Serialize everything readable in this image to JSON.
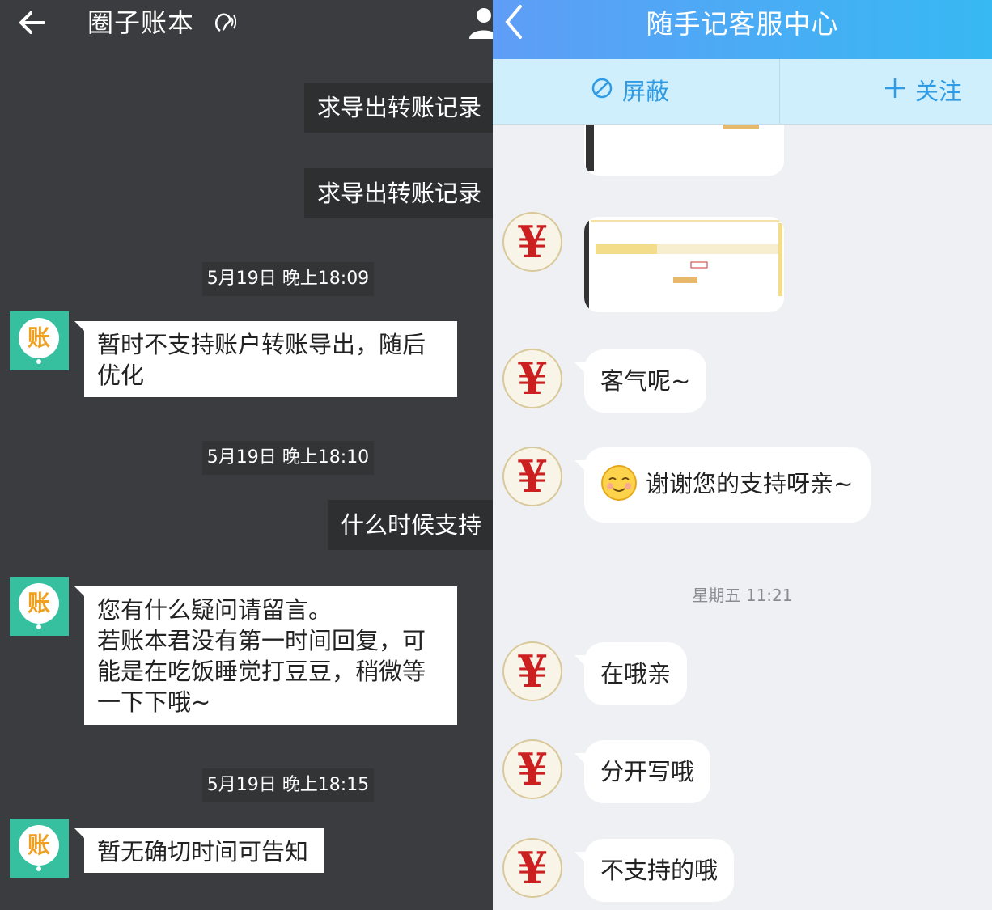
{
  "left": {
    "header": {
      "title": "圈子账本",
      "ear_icon": "ear-icon"
    },
    "messages": [
      {
        "type": "out",
        "text": "求导出转账记录"
      },
      {
        "type": "out",
        "text": "求导出转账记录"
      },
      {
        "type": "time",
        "text": "5月19日 晚上18:09"
      },
      {
        "type": "in",
        "text": "暂时不支持账户转账导出，随后优化"
      },
      {
        "type": "time",
        "text": "5月19日 晚上18:10"
      },
      {
        "type": "out",
        "text": "什么时候支持"
      },
      {
        "type": "in",
        "text": "您有什么疑问请留言。\n若账本君没有第一时间回复，可能是在吃饭睡觉打豆豆，稍微等一下下哦~"
      },
      {
        "type": "time",
        "text": "5月19日 晚上18:15"
      },
      {
        "type": "in",
        "text": "暂无确切时间可告知"
      }
    ],
    "avatar_char": "账"
  },
  "right": {
    "header": {
      "title": "随手记客服中心"
    },
    "actions": {
      "block_label": "屏蔽",
      "follow_label": "关注"
    },
    "messages": [
      {
        "type": "image"
      },
      {
        "type": "image"
      },
      {
        "type": "text",
        "text": "客气呢~"
      },
      {
        "type": "text",
        "text": "谢谢您的支持呀亲~",
        "emoji": "smile-emoji"
      },
      {
        "type": "time",
        "text": "星期五 11:21"
      },
      {
        "type": "text",
        "text": "在哦亲"
      },
      {
        "type": "text",
        "text": "分开写哦"
      },
      {
        "type": "text",
        "text": "不支持的哦"
      }
    ],
    "avatar_char": "¥"
  },
  "colors": {
    "left_bg": "#3b3c3f",
    "right_header": "#4aaaf5",
    "accent_blue": "#2e9be4",
    "avatar_green": "#36c0a0"
  }
}
